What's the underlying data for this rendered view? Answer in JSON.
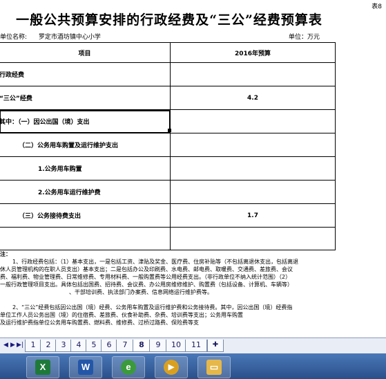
{
  "sheet": {
    "table_label": "表8",
    "title": "一般公共预算安排的行政经费及“三公”经费预算表",
    "unit_name_label": "单位名称:",
    "unit_name": "罗定市酒坊镇中心小学",
    "unit_label": "单位：万元",
    "headers": {
      "item": "项目",
      "budget": "2016年预算"
    },
    "rows": [
      {
        "label": "行政经费",
        "value": ""
      },
      {
        "label": "“三公”经费",
        "value": "4.2"
      },
      {
        "label": "其中：（一）因公出国（境）支出",
        "value": ""
      },
      {
        "label": "（二）公务用车购置及运行维护支出",
        "value": ""
      },
      {
        "label": "1.公务用车购置",
        "value": ""
      },
      {
        "label": "2.公务用车运行维护费",
        "value": ""
      },
      {
        "label": "（三）公务接待费支出",
        "value": "1.7"
      },
      {
        "label": "",
        "value": ""
      }
    ],
    "notes_label": "注：",
    "notes": [
      "1、行政经费包括：（1）基本支出，一是包括工资、津贴及奖金、医疗费、住房补贴等（不包括离退休支出，包括离退",
      "休人员管理机构的在职人员支出）基本支出；二是包括办公及印刷费、水电费、邮电费、取暖费、交通费、差旅费、会议",
      "费、福利费、物业管理费、日常维修费、专用材料费、一般购置费等公用经费支出。（非行政单位不纳入统计范围）（2）",
      "一般行政管理项目支出。具体包括出国费、招待费、会议费、办公用房维修维护、购置费（包括设备、计算机、车辆等）",
      "、干部培训费、执法部门办案费、信息网络运行维护费等。",
      "",
      "2、“三公”经费包括因公出国（境）经费、公务用车购置及运行维护费和公务接待费。其中，因公出国（境）经费指",
      "单位工作人员公务出国（境）的住宿费、差旅费、伙食补助费、杂费、培训费等支出；公务用车购置",
      "及运行维护费指单位公务用车购置费、燃料费、维修费、过桥过路费、保险费等支"
    ]
  },
  "tabs": [
    "1",
    "2",
    "3",
    "4",
    "5",
    "6",
    "7",
    "8",
    "9",
    "10",
    "11"
  ],
  "active_tab": "8",
  "taskbar": [
    {
      "icon": "excel-icon",
      "glyph": "X",
      "color": "#1f7a3a"
    },
    {
      "icon": "word-icon",
      "glyph": "W",
      "color": "#2456a8"
    },
    {
      "icon": "browser-icon",
      "glyph": "e",
      "color": "#3b9a3b"
    },
    {
      "icon": "media-icon",
      "glyph": "▶",
      "color": "#d9a020"
    },
    {
      "icon": "folder-icon",
      "glyph": "▭",
      "color": "#e6b84a"
    }
  ]
}
